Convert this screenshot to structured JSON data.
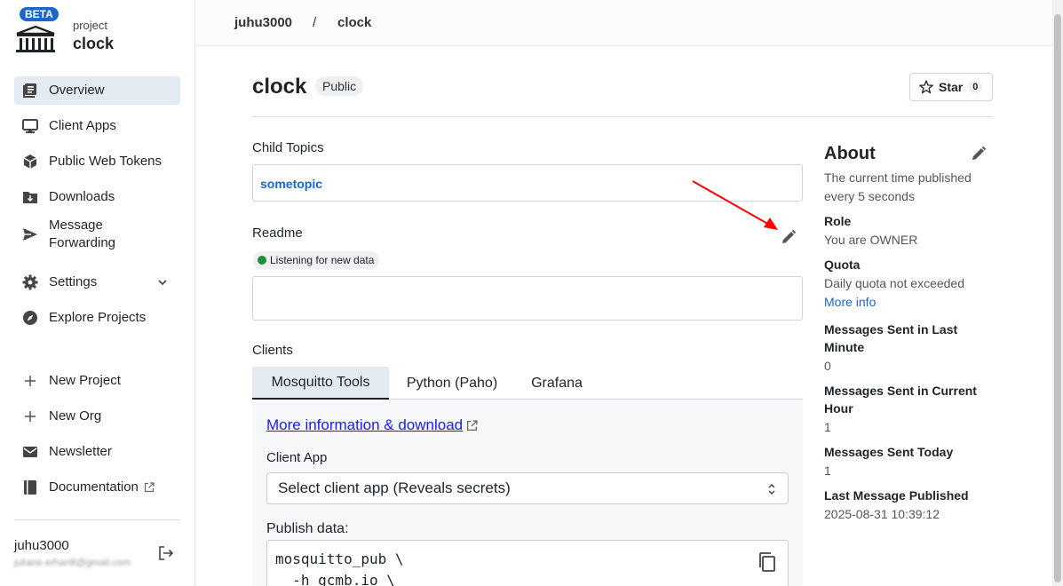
{
  "sidebar": {
    "beta": "BETA",
    "project_kind": "project",
    "project_name": "clock",
    "items": [
      {
        "label": "Overview",
        "icon": "overview-icon"
      },
      {
        "label": "Client Apps",
        "icon": "monitor-icon"
      },
      {
        "label": "Public Web Tokens",
        "icon": "cube-icon"
      },
      {
        "label": "Downloads",
        "icon": "download-folder-icon"
      },
      {
        "label": "Message Forwarding",
        "icon": "send-icon"
      },
      {
        "label": "Settings",
        "icon": "gear-icon"
      },
      {
        "label": "Explore Projects",
        "icon": "compass-icon"
      }
    ],
    "actions": [
      {
        "label": "New Project",
        "icon": "plus-icon"
      },
      {
        "label": "New Org",
        "icon": "plus-icon"
      },
      {
        "label": "Newsletter",
        "icon": "mail-icon"
      },
      {
        "label": "Documentation",
        "icon": "book-icon"
      }
    ],
    "user": {
      "name": "juhu3000",
      "email": "juliane.erhardt@gmail.com"
    }
  },
  "breadcrumb": {
    "owner": "juhu3000",
    "separator": "/",
    "project": "clock"
  },
  "main": {
    "title": "clock",
    "visibility": "Public",
    "star_label": "Star",
    "star_count": "0",
    "child_topics_label": "Child Topics",
    "child_topic": "sometopic",
    "readme_label": "Readme",
    "listening": "Listening for new data",
    "clients_label": "Clients",
    "tabs": [
      "Mosquitto Tools",
      "Python (Paho)",
      "Grafana"
    ],
    "more_info": "More information & download",
    "client_app_label": "Client App",
    "client_app_select": "Select client app (Reveals secrets)",
    "publish_label": "Publish data:",
    "code_lines": [
      "mosquitto_pub \\",
      "  -h gcmb.io \\"
    ]
  },
  "about": {
    "title": "About",
    "description": "The current time published every 5 seconds",
    "role_label": "Role",
    "role_value": "You are OWNER",
    "quota_label": "Quota",
    "quota_value": "Daily quota not exceeded",
    "more_info": "More info",
    "last_minute_label": "Messages Sent in Last Minute",
    "last_minute_value": "0",
    "current_hour_label": "Messages Sent in Current Hour",
    "current_hour_value": "1",
    "today_label": "Messages Sent Today",
    "today_value": "1",
    "last_published_label": "Last Message Published",
    "last_published_value": "2025-08-31 10:39:12"
  },
  "colors": {
    "accent": "#1a66c9",
    "active_bg": "#e3eaf2",
    "status_green": "#1e8e3e",
    "annotation_red": "#ff0000"
  }
}
